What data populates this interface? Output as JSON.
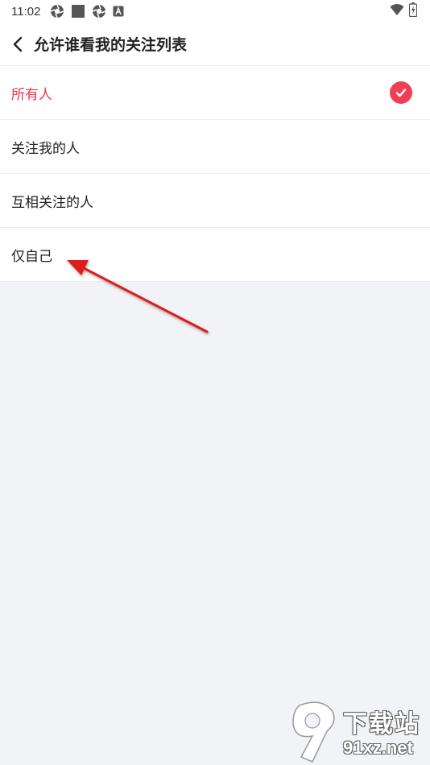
{
  "status_bar": {
    "time": "11:02",
    "icons": [
      "aperture-icon",
      "square-icon",
      "aperture-icon",
      "a-badge-icon"
    ],
    "right_icons": [
      "wifi-icon",
      "battery-charging-icon"
    ]
  },
  "header": {
    "back_icon": "chevron-left-icon",
    "title": "允许谁看我的关注列表"
  },
  "options": [
    {
      "label": "所有人",
      "selected": true
    },
    {
      "label": "关注我的人",
      "selected": false
    },
    {
      "label": "互相关注的人",
      "selected": false
    },
    {
      "label": "仅自己",
      "selected": false
    }
  ],
  "colors": {
    "accent": "#ef3f55",
    "background": "#f1f3f7",
    "arrow": "#e11d1d"
  },
  "watermark": {
    "logo_text": "9",
    "main": "下载站",
    "sub": "91xz.net"
  }
}
